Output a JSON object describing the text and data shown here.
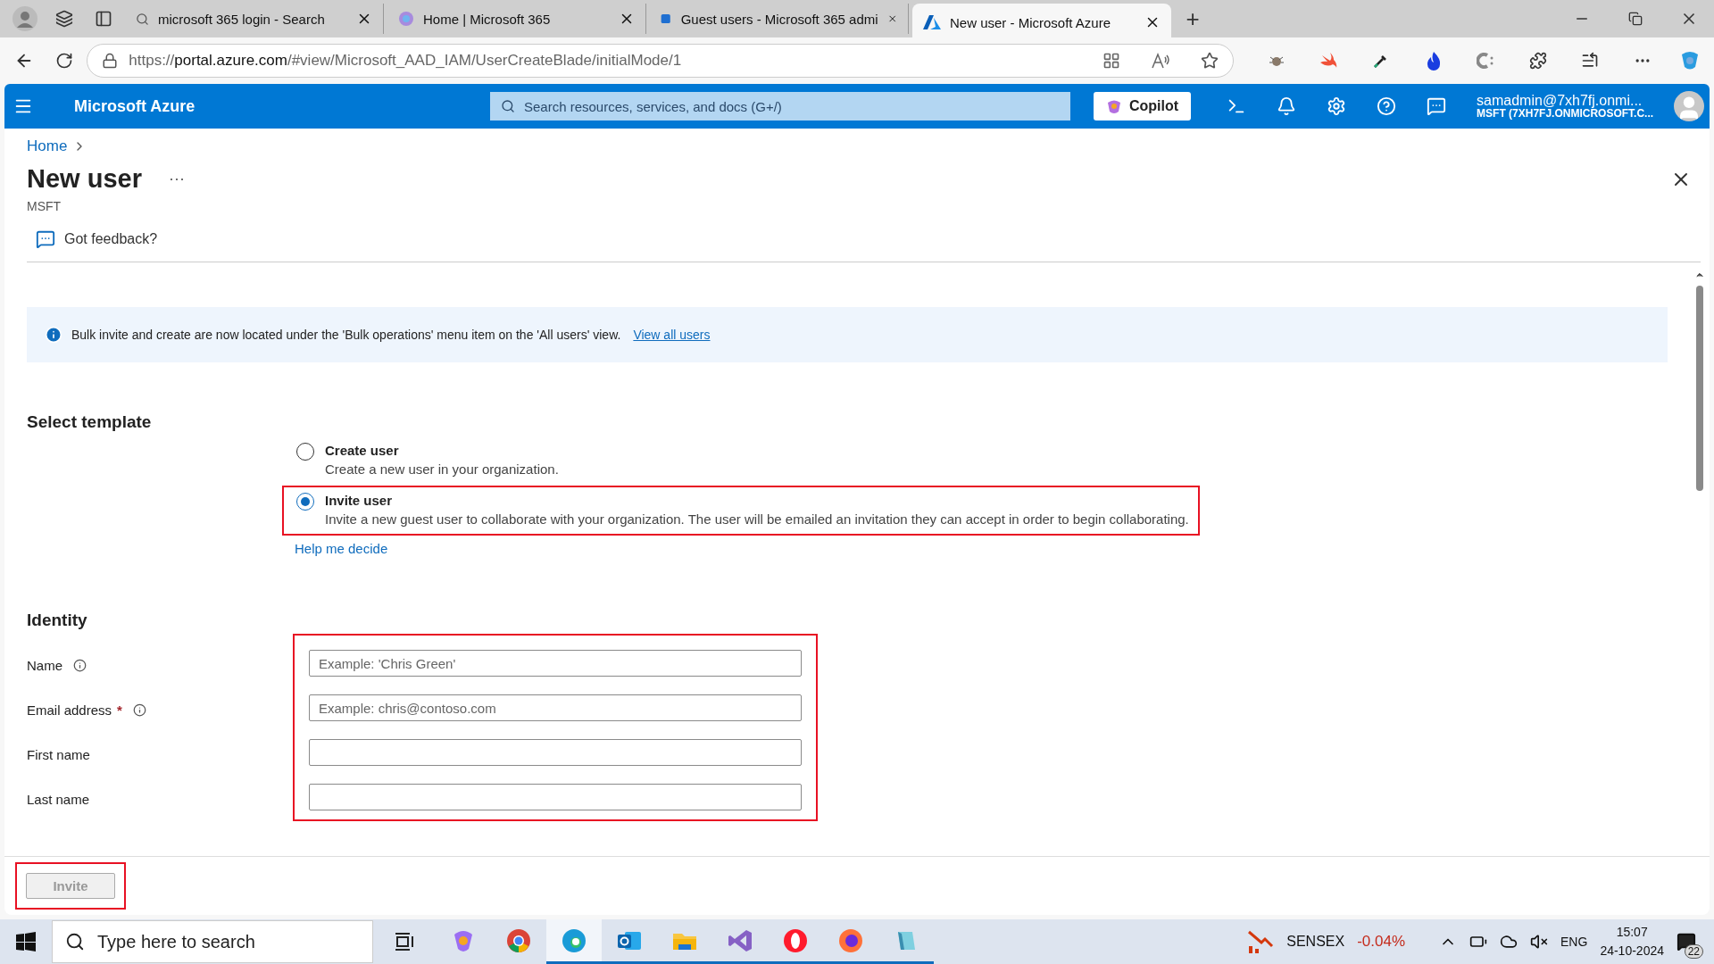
{
  "browser": {
    "tabs": [
      {
        "title": "microsoft 365 login - Search",
        "kind": "search",
        "selected": false
      },
      {
        "title": "Home | Microsoft 365",
        "kind": "m365",
        "selected": false
      },
      {
        "title": "Guest users - Microsoft 365 admi",
        "kind": "admin",
        "selected": false
      },
      {
        "title": "New user - Microsoft Azure",
        "kind": "azure",
        "selected": true
      }
    ],
    "new_tab": "+",
    "address": {
      "prefix": "https://",
      "host": "portal.azure.com",
      "path": "/#view/Microsoft_AAD_IAM/UserCreateBlade/initialMode/1"
    }
  },
  "portal": {
    "brand": "Microsoft Azure",
    "search_placeholder": "Search resources, services, and docs (G+/)",
    "copilot": "Copilot",
    "account": {
      "user": "samadmin@7xh7fj.onmi...",
      "tenant": "MSFT (7XH7FJ.ONMICROSOFT.C..."
    }
  },
  "breadcrumb": [
    "Home"
  ],
  "page": {
    "title": "New user",
    "more": "···",
    "subtitle": "MSFT",
    "feedback": "Got feedback?"
  },
  "banner": {
    "text": "Bulk invite and create are now located under the 'Bulk operations' menu item on the 'All users' view.",
    "link": "View all users"
  },
  "template": {
    "heading": "Select template",
    "options": [
      {
        "title": "Create user",
        "description": "Create a new user in your organization.",
        "selected": false,
        "highlighted": false
      },
      {
        "title": "Invite user",
        "description": "Invite a new guest user to collaborate with your organization. The user will be emailed an invitation they can accept in order to begin collaborating.",
        "selected": true,
        "highlighted": true
      }
    ],
    "help_link": "Help me decide"
  },
  "identity": {
    "heading": "Identity",
    "highlighted": true,
    "fields": [
      {
        "label": "Name",
        "placeholder": "Example: 'Chris Green'",
        "info": true
      },
      {
        "label": "Email address",
        "required_mark": "*",
        "placeholder": "Example: chris@contoso.com",
        "info": true
      },
      {
        "label": "First name",
        "info": false
      },
      {
        "label": "Last name",
        "info": false
      }
    ]
  },
  "footer": {
    "button": {
      "label": "Invite",
      "disabled": true,
      "highlighted": true
    }
  },
  "taskbar": {
    "search_placeholder": "Type here to search",
    "apps": [
      {
        "kind": "copilot",
        "running": false,
        "selected": false
      },
      {
        "kind": "chrome",
        "running": false,
        "selected": false
      },
      {
        "kind": "edge",
        "running": true,
        "selected": true
      },
      {
        "kind": "outlook",
        "running": true,
        "selected": false
      },
      {
        "kind": "files",
        "running": true,
        "selected": false
      },
      {
        "kind": "vs",
        "running": true,
        "selected": false
      },
      {
        "kind": "opera",
        "running": true,
        "selected": false
      },
      {
        "kind": "firefox",
        "running": true,
        "selected": false
      },
      {
        "kind": "notepad",
        "running": true,
        "selected": false
      }
    ],
    "ticker": {
      "name": "SENSEX",
      "change": "-0.04%"
    },
    "language": "ENG",
    "time": "15:07",
    "date": "24-10-2024",
    "notifications": "22"
  }
}
